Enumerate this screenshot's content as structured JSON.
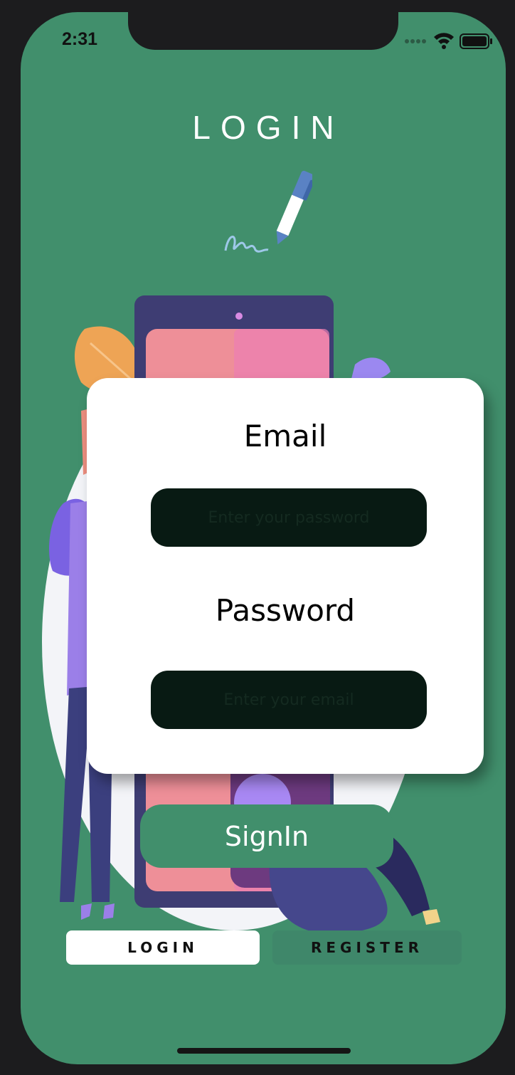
{
  "status_bar": {
    "time": "2:31"
  },
  "header": {
    "title": "LOGIN",
    "icon": "pen-signature-icon"
  },
  "form": {
    "email_label": "Email",
    "email_placeholder": "Enter your password",
    "password_label": "Password",
    "password_placeholder": "Enter your email",
    "signin_label": "SignIn"
  },
  "tabs": [
    {
      "label": "LOGIN",
      "active": true
    },
    {
      "label": "REGISTER",
      "active": false
    }
  ],
  "colors": {
    "background": "#418f6c",
    "field": "#081a13",
    "card": "#ffffff"
  }
}
